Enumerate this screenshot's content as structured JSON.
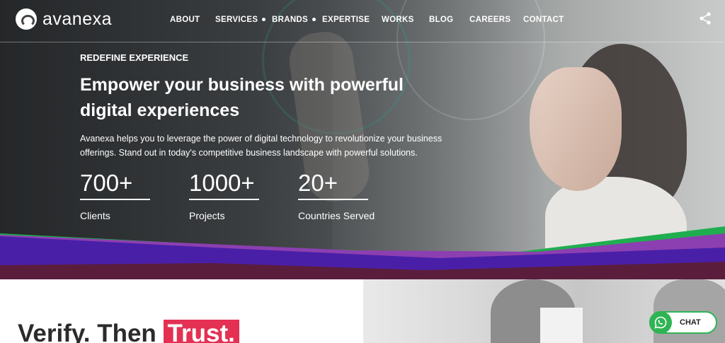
{
  "brand": {
    "name": "avanexa"
  },
  "nav": {
    "items": [
      {
        "label": "ABOUT",
        "has_dropdown": false
      },
      {
        "label": "SERVICES",
        "has_dropdown": true
      },
      {
        "label": "BRANDS",
        "has_dropdown": true
      },
      {
        "label": "EXPERTISE",
        "has_dropdown": false
      },
      {
        "label": "WORKS",
        "has_dropdown": false
      },
      {
        "label": "BLOG",
        "has_dropdown": false
      },
      {
        "label": "CAREERS",
        "has_dropdown": false
      },
      {
        "label": "CONTACT",
        "has_dropdown": false
      }
    ],
    "share_icon": "share-icon"
  },
  "hero": {
    "eyebrow": "REDEFINE EXPERIENCE",
    "headline": "Empower your business with powerful digital experiences",
    "description": "Avanexa helps you to leverage the power of digital technology to revolutionize your business offerings. Stand out in today's competitive business landscape with powerful solutions.",
    "stats": [
      {
        "value": "700+",
        "label": "Clients"
      },
      {
        "value": "1000+",
        "label": "Projects"
      },
      {
        "value": "20+",
        "label": "Countries Served"
      }
    ]
  },
  "section": {
    "title_part1": "Verify. Then",
    "title_highlight": "Trust."
  },
  "chat": {
    "label": "CHAT",
    "icon": "whatsapp-icon"
  },
  "colors": {
    "accent_red": "#e43053",
    "whatsapp_green": "#2fb454",
    "wave_purple": "#4a1fa8",
    "wave_green": "#1fae4f"
  }
}
